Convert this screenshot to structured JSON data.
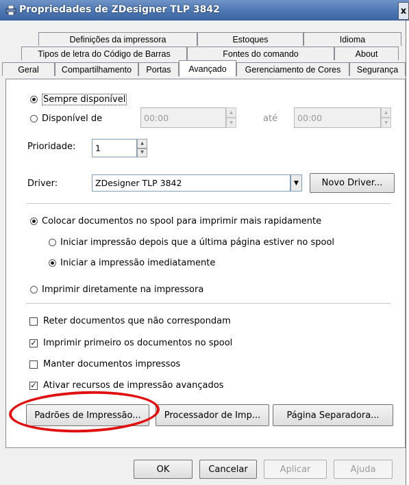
{
  "window": {
    "title": "Propriedades de ZDesigner TLP 3842",
    "close_label": "x"
  },
  "tabs": {
    "row1": [
      "Definições da impressora",
      "Estoques",
      "Idioma"
    ],
    "row2": [
      "Tipos de letra do Código de Barras",
      "Fontes do comando",
      "About"
    ],
    "row3": [
      "Geral",
      "Compartilhamento",
      "Portas",
      "Avançado",
      "Gerenciamento de Cores",
      "Segurança"
    ],
    "active": "Avançado"
  },
  "availability": {
    "always_label": "Sempre disponível",
    "always_checked": true,
    "from_label": "Disponível de",
    "from_checked": false,
    "from_time": "00:00",
    "until_label": "até",
    "until_time": "00:00"
  },
  "priority": {
    "label": "Prioridade:",
    "value": "1"
  },
  "driver": {
    "label": "Driver:",
    "value": "ZDesigner TLP 3842",
    "new_driver_button": "Novo Driver..."
  },
  "spool": {
    "spool_label": "Colocar documentos no spool para imprimir mais rapidamente",
    "spool_checked": true,
    "start_after_label": "Iniciar impressão depois que a última página estiver no spool",
    "start_after_checked": false,
    "start_immediately_label": "Iniciar a impressão imediatamente",
    "start_immediately_checked": true,
    "direct_label": "Imprimir diretamente na impressora",
    "direct_checked": false
  },
  "options": [
    {
      "label": "Reter documentos que não correspondam",
      "checked": false
    },
    {
      "label": "Imprimir primeiro os documentos no spool",
      "checked": true
    },
    {
      "label": "Manter documentos impressos",
      "checked": false
    },
    {
      "label": "Ativar recursos de impressão avançados",
      "checked": true
    }
  ],
  "panel_buttons": {
    "defaults": "Padrões de Impressão...",
    "processor": "Processador de Imp...",
    "separator": "Página Separadora..."
  },
  "dialog_buttons": {
    "ok": "OK",
    "cancel": "Cancelar",
    "apply": "Aplicar",
    "help": "Ajuda"
  },
  "colors": {
    "titlebar": "#4f79b4",
    "annotation": "#e01010"
  }
}
